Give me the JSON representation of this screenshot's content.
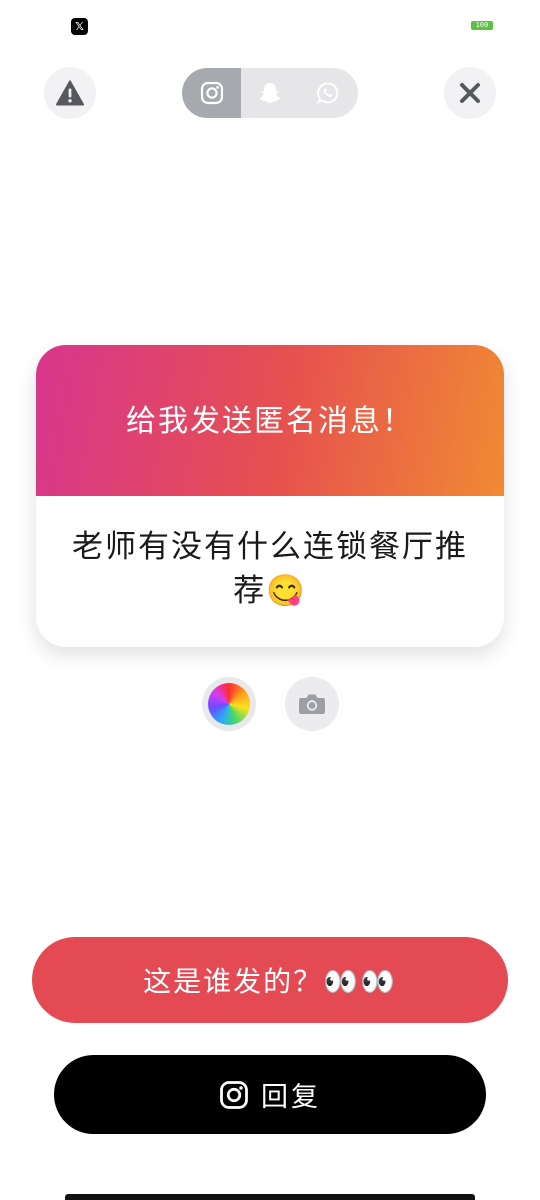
{
  "status_bar": {
    "app_icon_glyph": "𝕏",
    "battery_level": "100"
  },
  "top_bar": {
    "warn_icon": "warning-icon",
    "close_icon": "close-icon",
    "platforms": [
      {
        "name": "instagram",
        "icon": "instagram-icon",
        "selected": true
      },
      {
        "name": "snapchat",
        "icon": "snapchat-icon",
        "selected": false
      },
      {
        "name": "whatsapp",
        "icon": "whatsapp-icon",
        "selected": false
      }
    ]
  },
  "card": {
    "title": "给我发送匿名消息！",
    "message": "老师有没有什么连锁餐厅推荐😋",
    "gradient_colors": [
      "#d8368e",
      "#e6504f",
      "#f08a33"
    ]
  },
  "controls": {
    "color_icon": "color-wheel-icon",
    "camera_icon": "camera-icon"
  },
  "buttons": {
    "who_sent_label": "这是谁发的？👀👀",
    "reply_label": "回复",
    "who_sent_color": "#e34a54",
    "reply_color": "#000000"
  }
}
